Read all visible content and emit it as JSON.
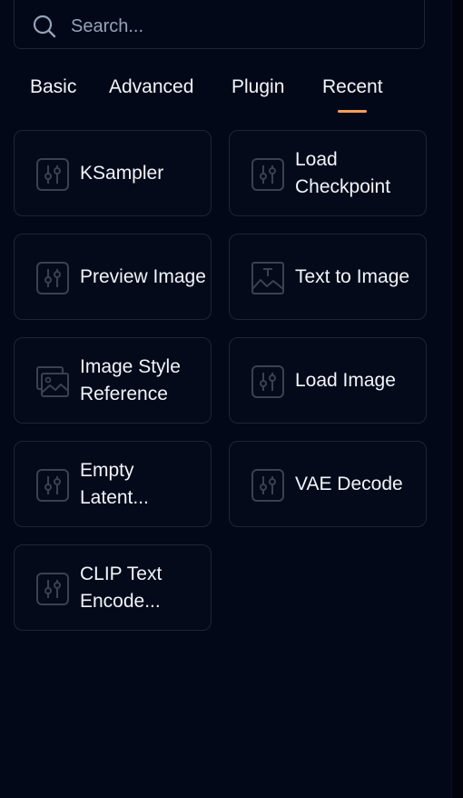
{
  "search": {
    "placeholder": "Search..."
  },
  "tabs": [
    {
      "label": "Basic",
      "active": false
    },
    {
      "label": "Advanced",
      "active": false
    },
    {
      "label": "Plugin",
      "active": false
    },
    {
      "label": "Recent",
      "active": true
    }
  ],
  "accent_color": "#f59e58",
  "nodes": [
    {
      "label": "KSampler",
      "icon": "sliders-icon"
    },
    {
      "label": "Load Checkpoint",
      "icon": "sliders-icon"
    },
    {
      "label": "Preview Image",
      "icon": "sliders-icon"
    },
    {
      "label": "Text to Image",
      "icon": "text-image-icon"
    },
    {
      "label": "Image Style Reference",
      "icon": "image-stack-icon"
    },
    {
      "label": "Load Image",
      "icon": "sliders-icon"
    },
    {
      "label": "Empty Latent...",
      "icon": "sliders-icon"
    },
    {
      "label": "VAE Decode",
      "icon": "sliders-icon"
    },
    {
      "label": "CLIP Text Encode...",
      "icon": "sliders-icon"
    }
  ]
}
